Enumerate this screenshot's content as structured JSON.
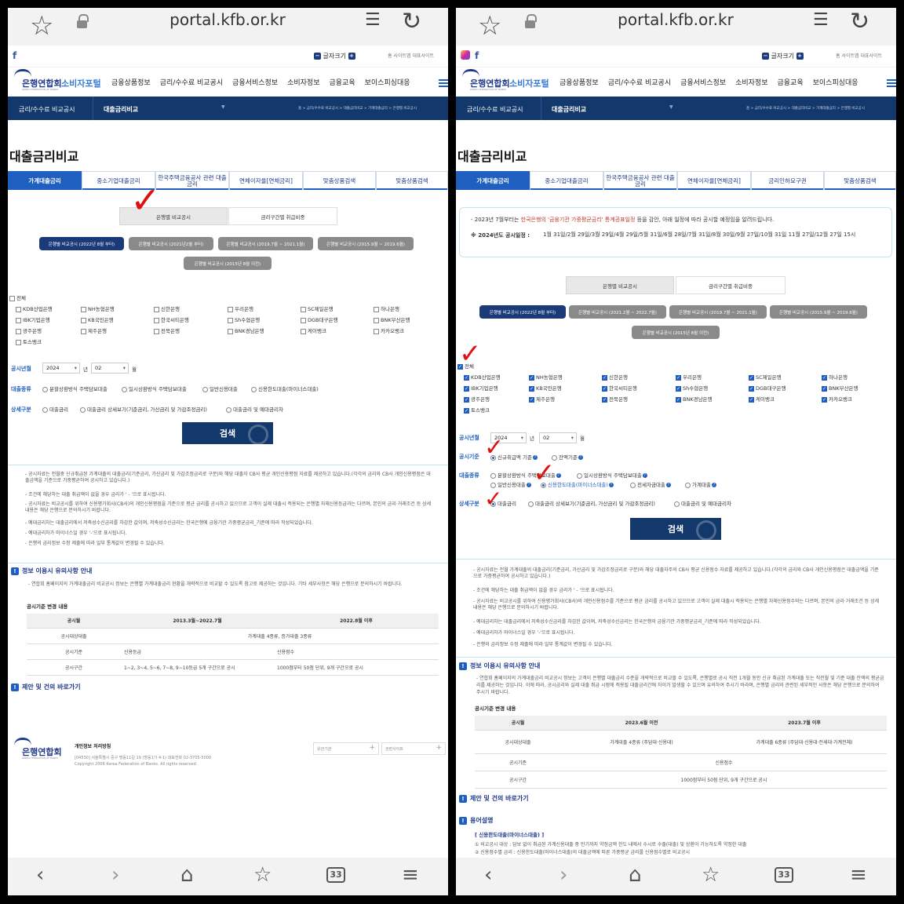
{
  "browser": {
    "url": "portal.kfb.or.kr"
  },
  "site": {
    "logo": "은행연합회",
    "portal": "소비자포털",
    "logo_en": "KOREA FEDERATION OF BANKS",
    "font_size": "글자크기",
    "util_links": [
      "홈",
      "사이트맵",
      "대표사이트"
    ],
    "menu": [
      "금융상품정보",
      "금리/수수료 비교공시",
      "금융서비스정보",
      "소비자정보",
      "금융교육",
      "보이스피싱대응"
    ]
  },
  "lnb": {
    "first": "금리/수수료 비교공시",
    "second": "대출금리비교",
    "crumb": "홈 > 금리/수수료 비교공시 > 대출금리비교 > 가계대출금리 > 은행별 비교공시"
  },
  "page_title": "대출금리비교",
  "left": {
    "tabs": [
      "가계대출금리",
      "중소기업대출금리",
      "한국주택금융공사 관련 대출금리",
      "연체이자율[연체금리]",
      "맞춤상품검색",
      "맞춤상품검색"
    ],
    "search_types": [
      "은행별 비교공시",
      "금리구간별 취급비중"
    ],
    "periods": [
      "은행별 비교공시 (2022년 8월 부터)",
      "은행별 비교공시 (2021년2월 부터)",
      "은행별 비교공시 (2019.7월 ~ 2021.1월)",
      "은행별 비교공시 (2015.9월 ~ 2019.6월)",
      "은행별 비교공시 (2015년 8월 이전)"
    ],
    "all": "전체",
    "banks": [
      "KDB산업은행",
      "NH농협은행",
      "신한은행",
      "우리은행",
      "SC제일은행",
      "하나은행",
      "IBK기업은행",
      "KB국민은행",
      "한국씨티은행",
      "Sh수협은행",
      "DGB대구은행",
      "BNK부산은행",
      "광주은행",
      "제주은행",
      "전북은행",
      "BNK경남은행",
      "케이뱅크",
      "카카오뱅크",
      "토스뱅크"
    ],
    "month_label": "공시년월",
    "year": "2024",
    "year_unit": "년",
    "month": "02",
    "month_unit": "월",
    "loan_type_label": "대출종류",
    "loan_types": [
      "분할상환방식 주택담보대출",
      "일시상환방식 주택담보대출",
      "일반신용대출",
      "신용한도대출(마이너스대출)"
    ],
    "detail_label": "상세구분",
    "details": [
      "대출금리",
      "대출금리 상세보기(기준금리, 가산금리 및 가감조정금리)",
      "대출금리 및 예대금리차"
    ],
    "search": "검색",
    "info": [
      "- 공시자료는 전월중 신규취급된 가계대출의 대출금리(기준금리, 가산금리 및 가감조정금리로 구분)와 해당 대출자 CB사 평균 개인신용평점 자료를 제공하고 있습니다.(각각의 금리와 CB사 개인신용평점은 대출금액을 기준으로 가중평균하여 공시하고 있습니다.)",
      "- 조건에 해당하는 대출 취급액이 없을 경우 금리가 ' - '으로 표시됩니다.",
      "- 공시자료는 비교공시를 위하여 신용평가회사(CB사)의 개인신용평점을 기준으로 평균 금리를 공시하고 있으므로 고객이 실제 대출시 적용되는 은행별 자체신용등급과는 다르며, 본인의 금리·거래조건 등 상세내용은 해당 은행으로 문의하시기 바랍니다.",
      "- 예대금리차는 대출금리에서 저축성수신금리를 차감한 값이며, 저축성수신금리는 한국은행에 금융기관 가중평균금리_기준에 따라 작성되었습니다.",
      "- 예대금리차가 마이너스일 경우 '-'으로 표시됩니다.",
      "- 은행의 금리정보 수정 제출에 따라 일부 통계값이 변경될 수 있습니다."
    ],
    "notice_title": "정보 이용시 유의사항 안내",
    "notice_text": "- 연합회 홈페이지의 가계대출금리 비교공시 정보는 은행별 가계대출금리 현황을 개략적으로 비교할 수 있도록 참고로 제공하는 것입니다. 기타 세부사항은 해당 은행으로 문의하시기 바랍니다.",
    "change_title": "공시기준 변경 내용",
    "table_head": [
      "공시월",
      "2013.3월~2022.7월",
      "2022.8월 이후"
    ],
    "table_rows": [
      [
        "공시대상대출",
        "가계대출 4종류, 증가대출 3종류",
        ""
      ],
      [
        "공시기준",
        "신용등급",
        "신용점수"
      ],
      [
        "공시구간",
        "1~2, 3~4, 5~6, 7~8, 9~10등급 5개 구간으로 공시",
        "1000점부터 50점 단위, 9개 구간으로 공시"
      ]
    ],
    "proposal": "제안 및 건의 바로가기",
    "footer": {
      "privacy": "개인정보 처리방침",
      "address": "[04530] 서울특별시 중구 명동11길 19 (명동1가 4-1)   대표전화 02-3705-5000",
      "copyright": "Copyright 2006 Korea Federation of Banks. All rights reserved",
      "select1": "유관기관",
      "select2": "관련사이트"
    }
  },
  "right": {
    "tabs": [
      "가계대출금리",
      "중소기업대출금리",
      "한국주택금융공사 관련 대출금리",
      "연체이자율[연체금리]",
      "금리인하요구권",
      "맞춤상품검색"
    ],
    "notice_line1a": "- 2023년 7월부터는 ",
    "notice_line1b": "한국은행의 '금융기관 가중평균금리' 통계공표일정",
    "notice_line1c": " 등을 감안, 아래 일정에 따라 공시할 예정임을 알려드립니다.",
    "schedule_label": "※ 2024년도 공시일정 :",
    "schedule": "1월 31일/2월 29일/3월 29일/4월 29일/5월 31일/6월 28일/7월 31일/8월 30일/9월 27일/10월 31일 11월 27일/12월 27일 15시",
    "periods": [
      "은행별 비교공시 (2022년 8월 부터)",
      "은행별 비교공시 (2021.2월 ~ 2022.7월)",
      "은행별 비교공시 (2019.7월 ~ 2021.1월)",
      "은행별 비교공시 (2015.9월 ~ 2019.6월)",
      "은행별 비교공시 (2015년 8월 이전)"
    ],
    "basis_label": "공시기준",
    "basis": [
      "신규취급액 기준",
      "잔액기준"
    ],
    "loan_types": [
      "분할상환방식 주택담보대출",
      "일시상환방식 주택담보대출",
      "전세자금대출",
      "일반신용대출",
      "신용한도대출(마이너스대출)",
      "가계대출"
    ],
    "info": [
      "- 공시자료는 전월 가계대출의 대출금리(기준금리, 가산금리 및 가감조정금리로 구분)와 해당 대출자주의 CB사 평균 신용점수 자료를 제공하고 있습니다.(각각의 금리와 CB사 개인신용평점은 대출금액을 기준으로 가중평균하여 공시하고 있습니다.)",
      "- 조건에 해당하는 대출 취급액이 없을 경우 금리가 ' - '으로 표시됩니다.",
      "- 공시자료는 비교공시를 위하여 신용평가회사(CB사)의 개인신용점수를 기준으로 평균 금리를 공시하고 있으므로 고객이 실제 대출시 적용되는 은행별 자체신용점수와는 다르며, 본인의 금리·거래조건 등 상세내용은 해당 은행으로 문의하시기 바랍니다.",
      "- 예대금리차는 대출금리에서 저축성수신금리를 차감한 값이며, 저축성수신금리는 한국은행의 금융기관 가중평균금리_기준에 따라 작성되었습니다.",
      "- 예대금리차가 마이너스일 경우 '-'으로 표시됩니다.",
      "- 은행의 금리정보 수정 제출에 따라 일부 통계값이 변경될 수 있습니다."
    ],
    "notice_text": "- 연합회 홈페이지의 가계대출금리 비교공시 정보는 고객이 은행별 대출금리 수준을 개략적으로 비교할 수 있도록, 은행별로 공시 직전 1개월 동안 신규 취급된 가계대출 또는 직전월 및 기준 대출 잔액의 평균금리를 제공하는 것입니다. 이에 따라, 공시금리와 실제 대출 취급 시점에 적용될 대출금리간에 차이가 발생할 수 있으며 유의하여 주시기 바라며, 은행별 금리와 관련된 세부적인 사항은 해당 은행으로 문의하여 주시기 바랍니다.",
    "table_head": [
      "공시월",
      "2023.6월 이전",
      "2023.7월 이후"
    ],
    "table_rows": [
      [
        "공시대상대출",
        "가계대출 4종류 (주담대·신용대)",
        "가계대출 6종류 (주담대·신용대·전세대·가계전체)"
      ],
      [
        "공시기준",
        "신용점수",
        ""
      ],
      [
        "공시구간",
        "1000점부터 50점 단위, 9개 구간으로 공시",
        ""
      ]
    ],
    "glossary": "용어설명",
    "glossary_item": "[ 신용한도대출(마이너스대출) ]",
    "glossary_l1": "① 비교공시 대상 : 담보 없이 취급된 가계신용대출 중 만기까지 약정금액 한도 내에서 수시로 수출(대출) 및 상환이 가능하도록 약정한 대출",
    "glossary_l2": "② 신용점수별 금리 : 신용한도대출(마이너스대출)의 대출금액에 따른 가중평균 금리를 신용점수별로 비교공시"
  }
}
